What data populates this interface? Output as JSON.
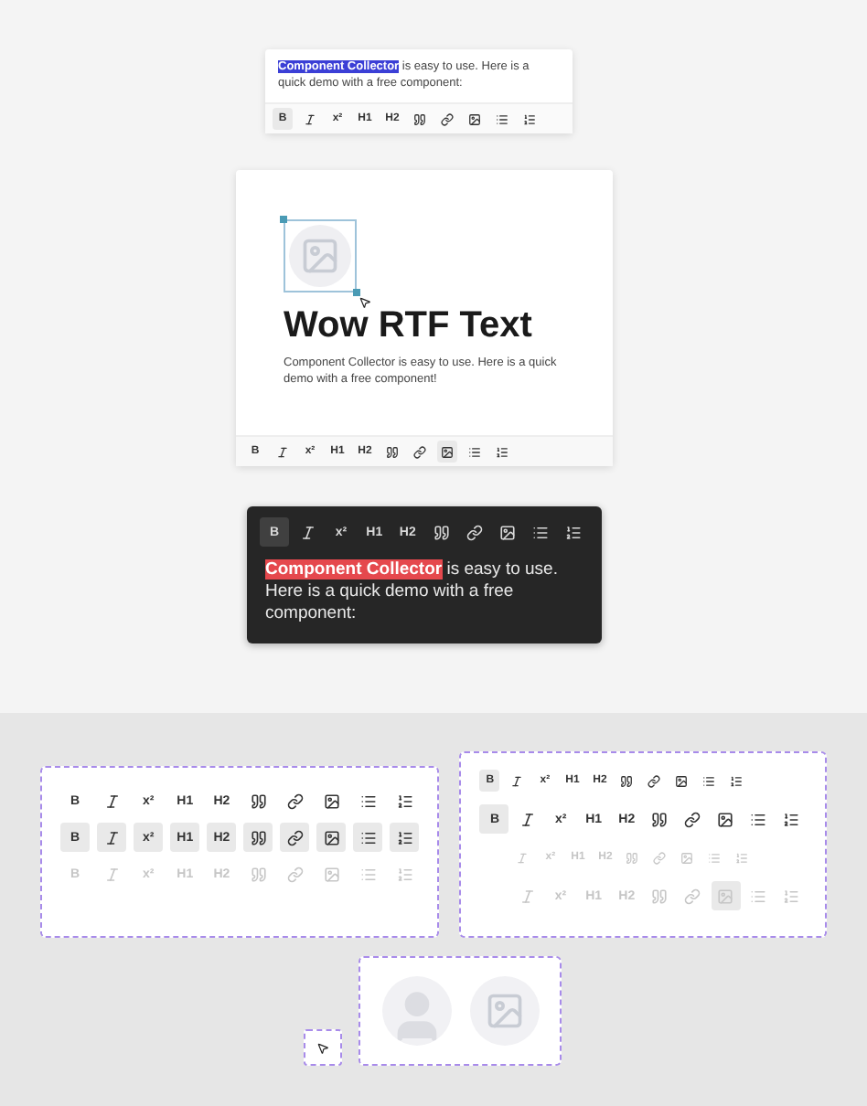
{
  "selection_card": {
    "highlighted": "Component Collector",
    "rest": " is easy to use. Here is a quick demo with a free component:",
    "toolbar": {
      "disabled": false,
      "buttons": [
        {
          "kind": "bold",
          "label": "B",
          "selected": true
        },
        {
          "kind": "italic",
          "selected": false
        },
        {
          "kind": "superscript",
          "label": "x²",
          "selected": false
        },
        {
          "kind": "h1",
          "label": "H1",
          "selected": false
        },
        {
          "kind": "h2",
          "label": "H2",
          "selected": false
        },
        {
          "kind": "quote",
          "selected": false
        },
        {
          "kind": "link",
          "selected": false
        },
        {
          "kind": "image",
          "selected": false
        },
        {
          "kind": "bullets",
          "selected": false
        },
        {
          "kind": "numbers",
          "selected": false
        }
      ]
    }
  },
  "image_card": {
    "title": "Wow RTF Text",
    "body": "Component Collector is easy to use. Here is a quick demo with a free component!",
    "toolbar": {
      "disabled": false,
      "buttons": [
        {
          "kind": "bold",
          "label": "B",
          "selected": false
        },
        {
          "kind": "italic",
          "selected": false
        },
        {
          "kind": "superscript",
          "label": "x²",
          "selected": false
        },
        {
          "kind": "h1",
          "label": "H1",
          "selected": false
        },
        {
          "kind": "h2",
          "label": "H2",
          "selected": false
        },
        {
          "kind": "quote",
          "selected": false
        },
        {
          "kind": "link",
          "selected": false
        },
        {
          "kind": "image",
          "selected": true
        },
        {
          "kind": "bullets",
          "selected": false
        },
        {
          "kind": "numbers",
          "selected": false
        }
      ]
    }
  },
  "dark_card": {
    "highlighted": "Component Collector",
    "rest": " is easy to use. Here is a quick demo with a free component:",
    "toolbar": {
      "disabled": false,
      "buttons": [
        {
          "kind": "bold",
          "label": "B",
          "selected": true
        },
        {
          "kind": "italic",
          "selected": false
        },
        {
          "kind": "superscript",
          "label": "x²",
          "selected": false
        },
        {
          "kind": "h1",
          "label": "H1",
          "selected": false
        },
        {
          "kind": "h2",
          "label": "H2",
          "selected": false
        },
        {
          "kind": "quote",
          "selected": false
        },
        {
          "kind": "link",
          "selected": false
        },
        {
          "kind": "image",
          "selected": false
        },
        {
          "kind": "bullets",
          "selected": false
        },
        {
          "kind": "numbers",
          "selected": false
        }
      ]
    }
  },
  "state_panel": [
    {
      "disabled": false,
      "buttons": [
        {
          "kind": "bold",
          "label": "B",
          "selected": false
        },
        {
          "kind": "italic",
          "selected": false
        },
        {
          "kind": "superscript",
          "label": "x²",
          "selected": false
        },
        {
          "kind": "h1",
          "label": "H1",
          "selected": false
        },
        {
          "kind": "h2",
          "label": "H2",
          "selected": false
        },
        {
          "kind": "quote",
          "selected": false
        },
        {
          "kind": "link",
          "selected": false
        },
        {
          "kind": "image",
          "selected": false
        },
        {
          "kind": "bullets",
          "selected": false
        },
        {
          "kind": "numbers",
          "selected": false
        }
      ]
    },
    {
      "disabled": false,
      "buttons": [
        {
          "kind": "bold",
          "label": "B",
          "selected": true
        },
        {
          "kind": "italic",
          "selected": true
        },
        {
          "kind": "superscript",
          "label": "x²",
          "selected": true
        },
        {
          "kind": "h1",
          "label": "H1",
          "selected": true
        },
        {
          "kind": "h2",
          "label": "H2",
          "selected": true
        },
        {
          "kind": "quote",
          "selected": true
        },
        {
          "kind": "link",
          "selected": true
        },
        {
          "kind": "image",
          "selected": true
        },
        {
          "kind": "bullets",
          "selected": true
        },
        {
          "kind": "numbers",
          "selected": true
        }
      ]
    },
    {
      "disabled": true,
      "buttons": [
        {
          "kind": "bold",
          "label": "B",
          "selected": false
        },
        {
          "kind": "italic",
          "selected": false
        },
        {
          "kind": "superscript",
          "label": "x²",
          "selected": false
        },
        {
          "kind": "h1",
          "label": "H1",
          "selected": false
        },
        {
          "kind": "h2",
          "label": "H2",
          "selected": false
        },
        {
          "kind": "quote",
          "selected": false
        },
        {
          "kind": "link",
          "selected": false
        },
        {
          "kind": "image",
          "selected": false
        },
        {
          "kind": "bullets",
          "selected": false
        },
        {
          "kind": "numbers",
          "selected": false
        }
      ]
    }
  ],
  "size_panel": [
    {
      "kind": "compact",
      "disabled": false,
      "buttons": [
        {
          "kind": "bold",
          "label": "B",
          "selected": true
        },
        {
          "kind": "italic",
          "selected": false
        },
        {
          "kind": "superscript",
          "label": "x²",
          "selected": false
        },
        {
          "kind": "h1",
          "label": "H1",
          "selected": false
        },
        {
          "kind": "h2",
          "label": "H2",
          "selected": false
        },
        {
          "kind": "quote",
          "selected": false
        },
        {
          "kind": "link",
          "selected": false
        },
        {
          "kind": "image",
          "selected": false
        },
        {
          "kind": "bullets",
          "selected": false
        },
        {
          "kind": "numbers",
          "selected": false
        }
      ]
    },
    {
      "kind": "regular",
      "disabled": false,
      "buttons": [
        {
          "kind": "bold",
          "label": "B",
          "selected": true
        },
        {
          "kind": "italic",
          "selected": false
        },
        {
          "kind": "superscript",
          "label": "x²",
          "selected": false
        },
        {
          "kind": "h1",
          "label": "H1",
          "selected": false
        },
        {
          "kind": "h2",
          "label": "H2",
          "selected": false
        },
        {
          "kind": "quote",
          "selected": false
        },
        {
          "kind": "link",
          "selected": false
        },
        {
          "kind": "image",
          "selected": false
        },
        {
          "kind": "bullets",
          "selected": false
        },
        {
          "kind": "numbers",
          "selected": false
        }
      ]
    },
    {
      "kind": "compact",
      "disabled": true,
      "buttons": [
        {
          "kind": "italic",
          "selected": false
        },
        {
          "kind": "superscript",
          "label": "x²",
          "selected": false
        },
        {
          "kind": "h1",
          "label": "H1",
          "selected": false
        },
        {
          "kind": "h2",
          "label": "H2",
          "selected": false
        },
        {
          "kind": "quote",
          "selected": false
        },
        {
          "kind": "link",
          "selected": false
        },
        {
          "kind": "image",
          "selected": false
        },
        {
          "kind": "bullets",
          "selected": false
        },
        {
          "kind": "numbers",
          "selected": false
        }
      ]
    },
    {
      "kind": "regular",
      "disabled": true,
      "buttons": [
        {
          "kind": "italic",
          "selected": false
        },
        {
          "kind": "superscript",
          "label": "x²",
          "selected": false
        },
        {
          "kind": "h1",
          "label": "H1",
          "selected": false
        },
        {
          "kind": "h2",
          "label": "H2",
          "selected": false
        },
        {
          "kind": "quote",
          "selected": false
        },
        {
          "kind": "link",
          "selected": false
        },
        {
          "kind": "image",
          "selected": true
        },
        {
          "kind": "bullets",
          "selected": false
        },
        {
          "kind": "numbers",
          "selected": false
        }
      ]
    }
  ]
}
